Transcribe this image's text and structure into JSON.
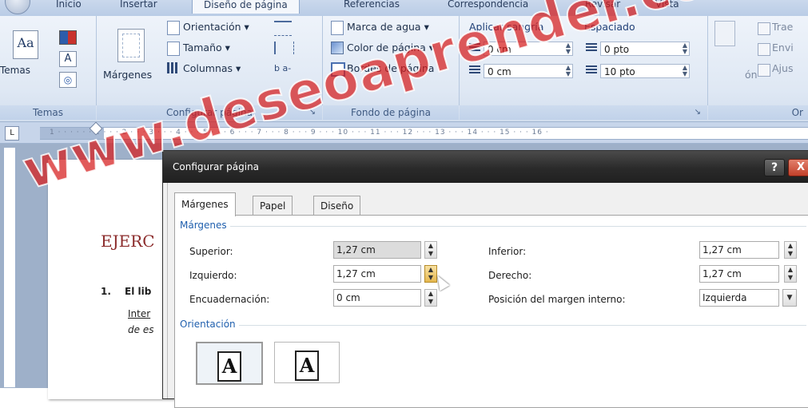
{
  "ribbon": {
    "tabs": [
      {
        "label": "Inicio"
      },
      {
        "label": "Insertar"
      },
      {
        "label": "Diseño de página"
      },
      {
        "label": "Referencias"
      },
      {
        "label": "Correspondencia"
      },
      {
        "label": "Revisar"
      },
      {
        "label": "Vista"
      }
    ],
    "temas": {
      "button": "Temas",
      "group": "Temas"
    },
    "configurar": {
      "margenes": "Márgenes",
      "orientacion": "Orientación",
      "tamano": "Tamaño",
      "columnas": "Columnas",
      "group": "Configurar página"
    },
    "fondo": {
      "marca_agua": "Marca de agua",
      "color_pagina": "Color de página",
      "bordes_pagina": "Bordes de página",
      "group": "Fondo de página"
    },
    "parrafo": {
      "aplicar_sangria": "Aplicar sangría",
      "espaciado": "Espaciado",
      "sangria_izq": "0 cm",
      "sangria_der": "0 cm",
      "espaciado_antes": "0 pto",
      "espaciado_despues": "10 pto",
      "posicion_partial": "ón"
    },
    "organizar": {
      "traer": "Trae",
      "enviar": "Envi",
      "ajustar": "Ajus",
      "group": "Or"
    }
  },
  "ruler": {
    "marks": "1 · · · · · · 1 · · · 2 · · · 3 · · · 4 · · · 5 · · · 6 · · · 7 · · · 8 · · · 9 · · · 10 · · · 11 · · · 12 · · · 13 · · · 14 · · · 15 · · · 16 ·"
  },
  "document": {
    "heading": "EJERC",
    "item_number": "1.",
    "item_bold": "El lib",
    "line2": "Inter",
    "line3": "de es"
  },
  "dialog": {
    "title": "Configurar página",
    "help": "?",
    "close": "X",
    "tabs": [
      {
        "label": "Márgenes"
      },
      {
        "label": "Papel"
      },
      {
        "label": "Diseño"
      }
    ],
    "margenes_section": "Márgenes",
    "fields": {
      "superior": {
        "label": "Superior:",
        "value": "1,27 cm"
      },
      "izquierdo": {
        "label": "Izquierdo:",
        "value": "1,27 cm"
      },
      "encuadernacion": {
        "label": "Encuadernación:",
        "value": "0 cm"
      },
      "inferior": {
        "label": "Inferior:",
        "value": "1,27 cm"
      },
      "derecho": {
        "label": "Derecho:",
        "value": "1,27 cm"
      },
      "posicion": {
        "label": "Posición del margen interno:",
        "value": "Izquierda"
      }
    },
    "orientacion_section": "Orientación"
  },
  "watermark": "www.deseoaprender.com",
  "colors": {
    "accent": "#1f5fae",
    "watermark": "#d61c1c",
    "title_bar": "#2a2a2a",
    "close_button": "#c2402a"
  }
}
